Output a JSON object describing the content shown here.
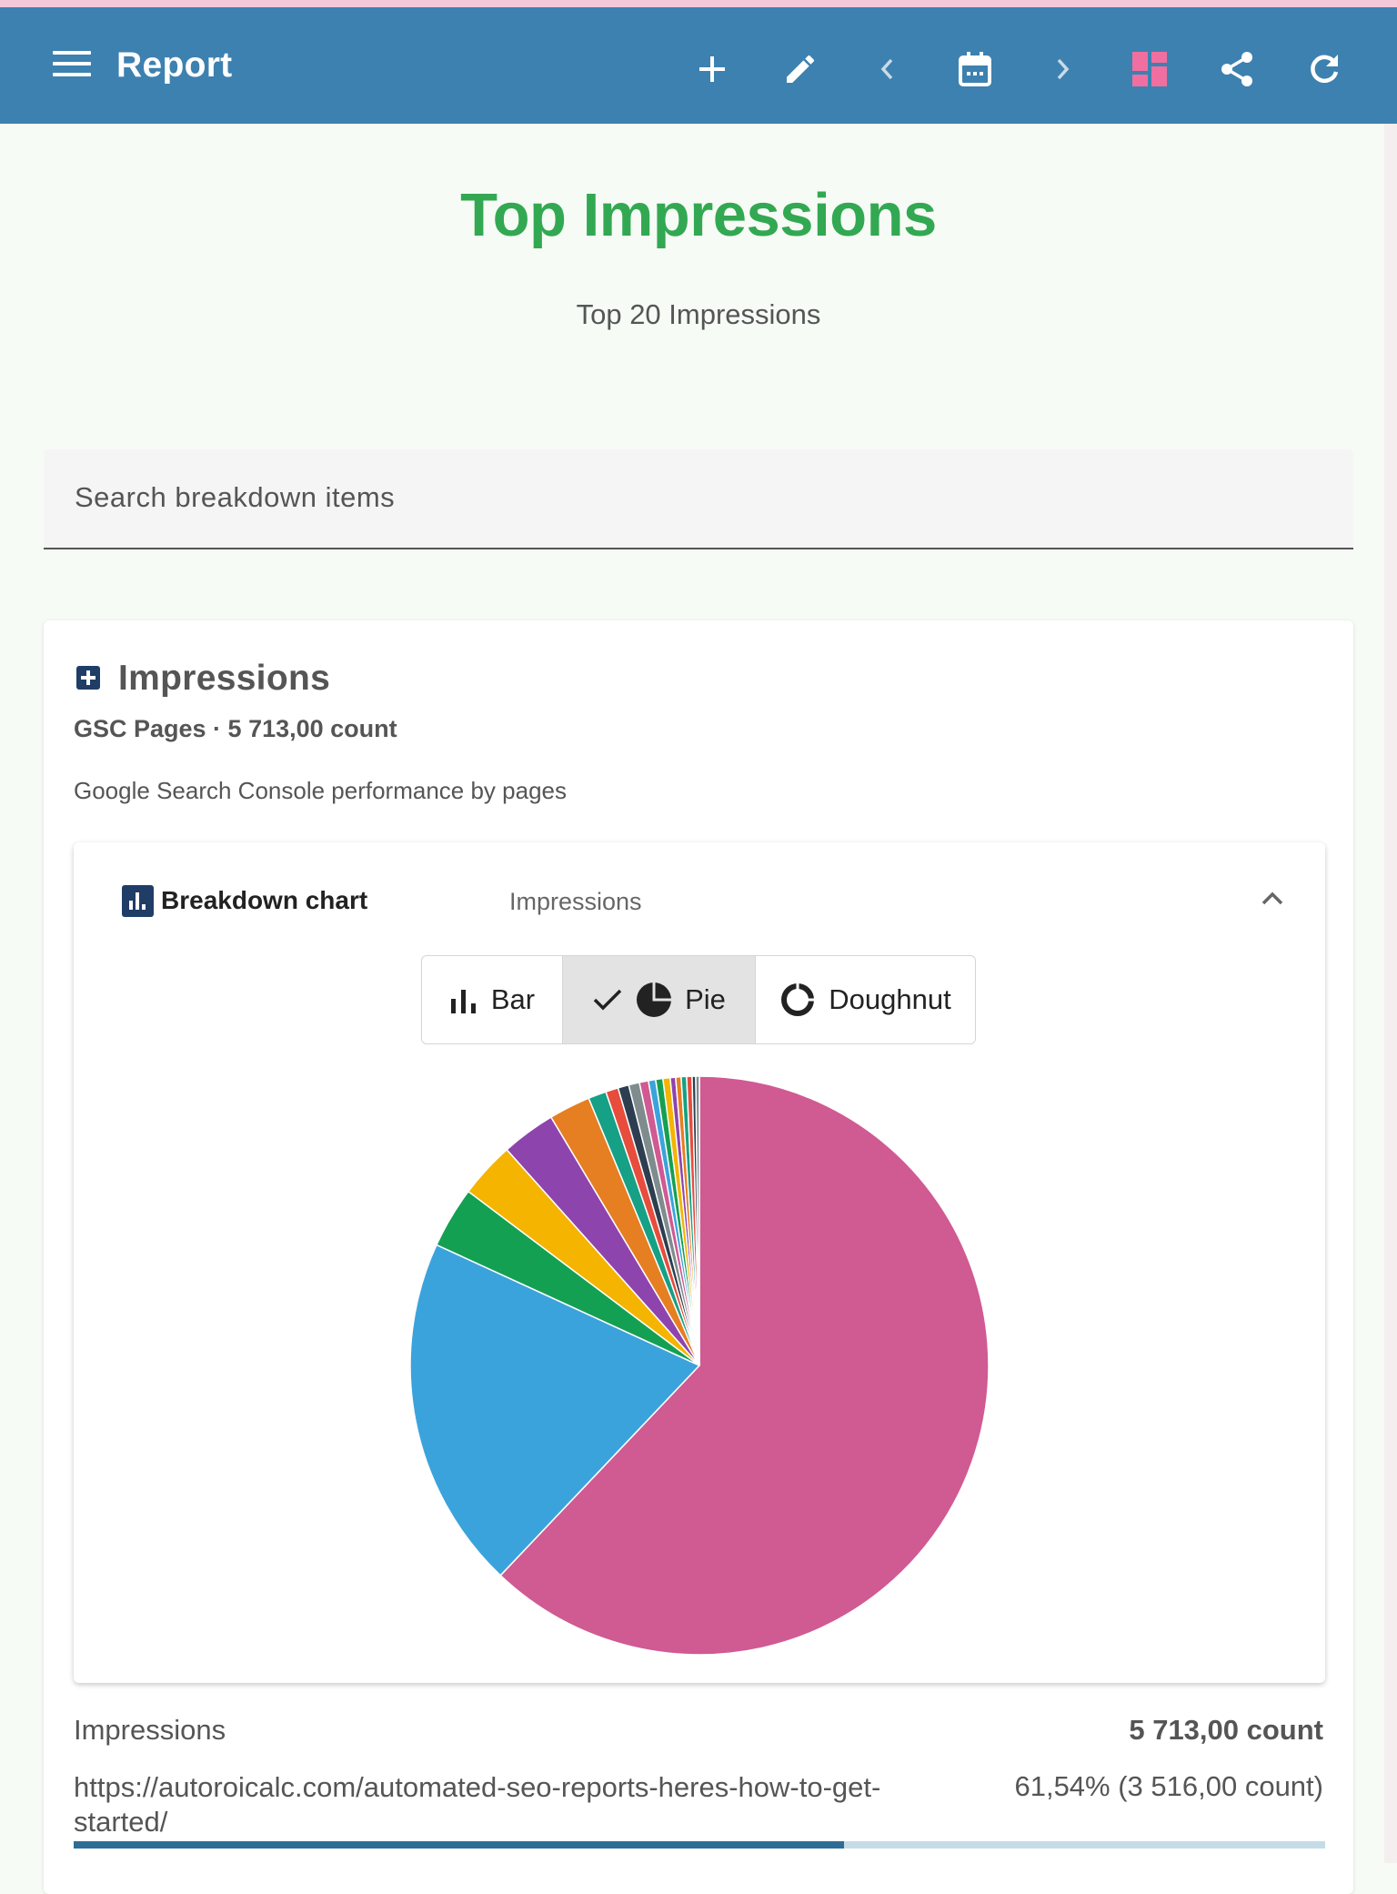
{
  "appbar": {
    "title": "Report",
    "color": "#3d81b0",
    "icons": [
      "menu-icon",
      "add-icon",
      "edit-icon",
      "chevron-left-icon",
      "calendar-icon",
      "chevron-right-icon",
      "dashboard-icon",
      "share-icon",
      "refresh-icon"
    ]
  },
  "header": {
    "title": "Top Impressions",
    "subtitle": "Top 20 Impressions"
  },
  "search": {
    "placeholder": "Search breakdown items"
  },
  "card": {
    "title": "Impressions",
    "meta": "GSC Pages · 5 713,00 count",
    "description": "Google Search Console performance by pages",
    "breakdown": {
      "label": "Breakdown chart",
      "metric": "Impressions",
      "chart_types": [
        "Bar",
        "Pie",
        "Doughnut"
      ],
      "selected_chart_type": "Pie"
    },
    "summary": {
      "label": "Impressions",
      "total": "5 713,00 count",
      "first_item": {
        "url": "https://autoroicalc.com/automated-seo-reports-heres-how-to-get-started/",
        "value": "61,54% (3 516,00 count)",
        "fraction": 0.6154
      }
    }
  },
  "chart_data": {
    "type": "pie",
    "title": "",
    "values": [
      61.54,
      19.6,
      3.4,
      3.1,
      3.0,
      2.3,
      1.0,
      0.7,
      0.6,
      0.6,
      0.5,
      0.4,
      0.4,
      0.4,
      0.3,
      0.3,
      0.3,
      0.3,
      0.2,
      0.2
    ],
    "colors": [
      "#d05a92",
      "#3ba3dc",
      "#14a052",
      "#f4b400",
      "#8e44ad",
      "#e67e22",
      "#16a085",
      "#e74c3c",
      "#2c3e50",
      "#7f8c8d",
      "#d05a92",
      "#3ba3dc",
      "#14a052",
      "#f4b400",
      "#8e44ad",
      "#e67e22",
      "#16a085",
      "#e74c3c",
      "#2c3e50",
      "#7f8c8d"
    ]
  }
}
